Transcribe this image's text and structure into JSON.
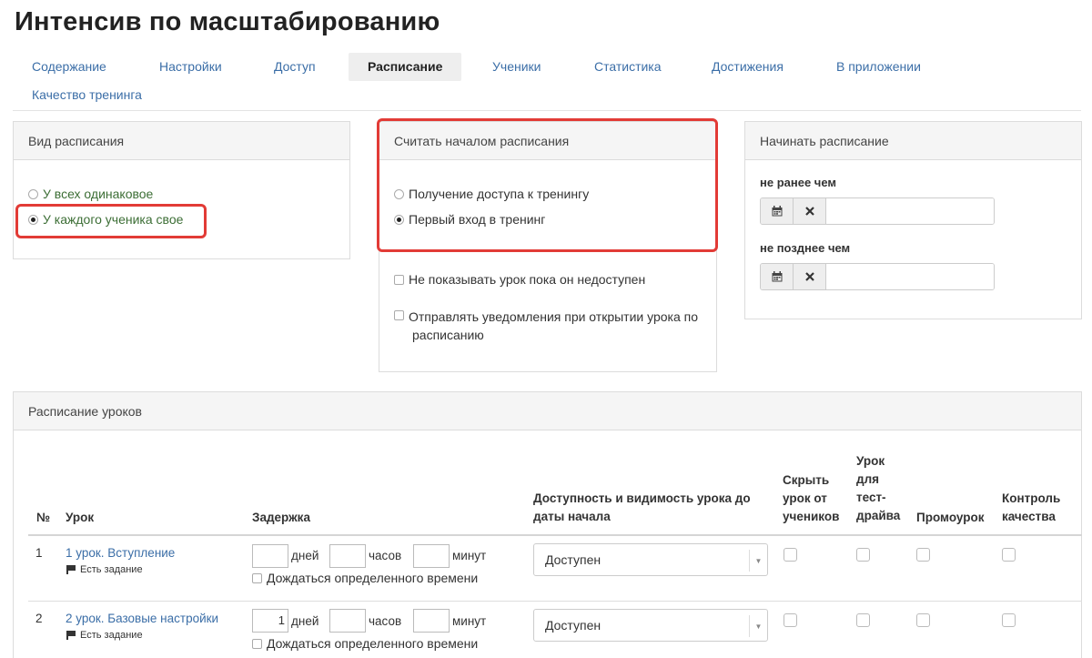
{
  "page": {
    "title": "Интенсив по масштабированию"
  },
  "tabs": [
    {
      "label": "Содержание"
    },
    {
      "label": "Настройки"
    },
    {
      "label": "Доступ"
    },
    {
      "label": "Расписание",
      "active": true
    },
    {
      "label": "Ученики"
    },
    {
      "label": "Статистика"
    },
    {
      "label": "Достижения"
    },
    {
      "label": "В приложении"
    },
    {
      "label": "Качество тренинга"
    }
  ],
  "schedule_type": {
    "title": "Вид расписания",
    "options": [
      {
        "label": "У всех одинаковое",
        "selected": false
      },
      {
        "label": "У каждого ученика свое",
        "selected": true
      }
    ]
  },
  "schedule_start": {
    "title": "Считать началом расписания",
    "options": [
      {
        "label": "Получение доступа к тренингу",
        "selected": false
      },
      {
        "label": "Первый вход в тренинг",
        "selected": true
      }
    ],
    "checks": [
      {
        "label": "Не показывать урок пока он недоступен",
        "checked": false
      },
      {
        "label_line1": "Отправлять уведомления при открытии урока по",
        "label_line2": "расписанию",
        "checked": false
      }
    ]
  },
  "start_schedule": {
    "title": "Начинать расписание",
    "not_earlier_label": "не ранее чем",
    "not_later_label": "не позднее чем",
    "calendar_icon": "calendar-icon",
    "clear_icon": "clear-icon"
  },
  "lessons": {
    "title": "Расписание уроков",
    "headers": {
      "num": "№",
      "lesson": "Урок",
      "delay": "Задержка",
      "availability_l1": "Доступность и видимость урока до",
      "availability_l2": "даты начала",
      "hide_l1": "Скрыть",
      "hide_l2": "урок от",
      "hide_l3": "учеников",
      "test_l1": "Урок",
      "test_l2": "для",
      "test_l3": "тест-",
      "test_l4": "драйва",
      "promo": "Промоурок",
      "qc_l1": "Контроль",
      "qc_l2": "качества"
    },
    "units": {
      "days": "дней",
      "hours": "часов",
      "minutes": "минут"
    },
    "wait_label": "Дождаться определенного времени",
    "task_label": "Есть задание",
    "rows": [
      {
        "num": "1",
        "title": "1 урок. Вступление",
        "days": "",
        "hours": "",
        "minutes": "",
        "availability": "Доступен"
      },
      {
        "num": "2",
        "title": "2 урок. Базовые настройки",
        "days": "1",
        "hours": "",
        "minutes": "",
        "availability": "Доступен"
      }
    ]
  },
  "colors": {
    "link": "#3b6ea7",
    "highlight": "#e23b36",
    "option_text": "#3c6e35"
  }
}
